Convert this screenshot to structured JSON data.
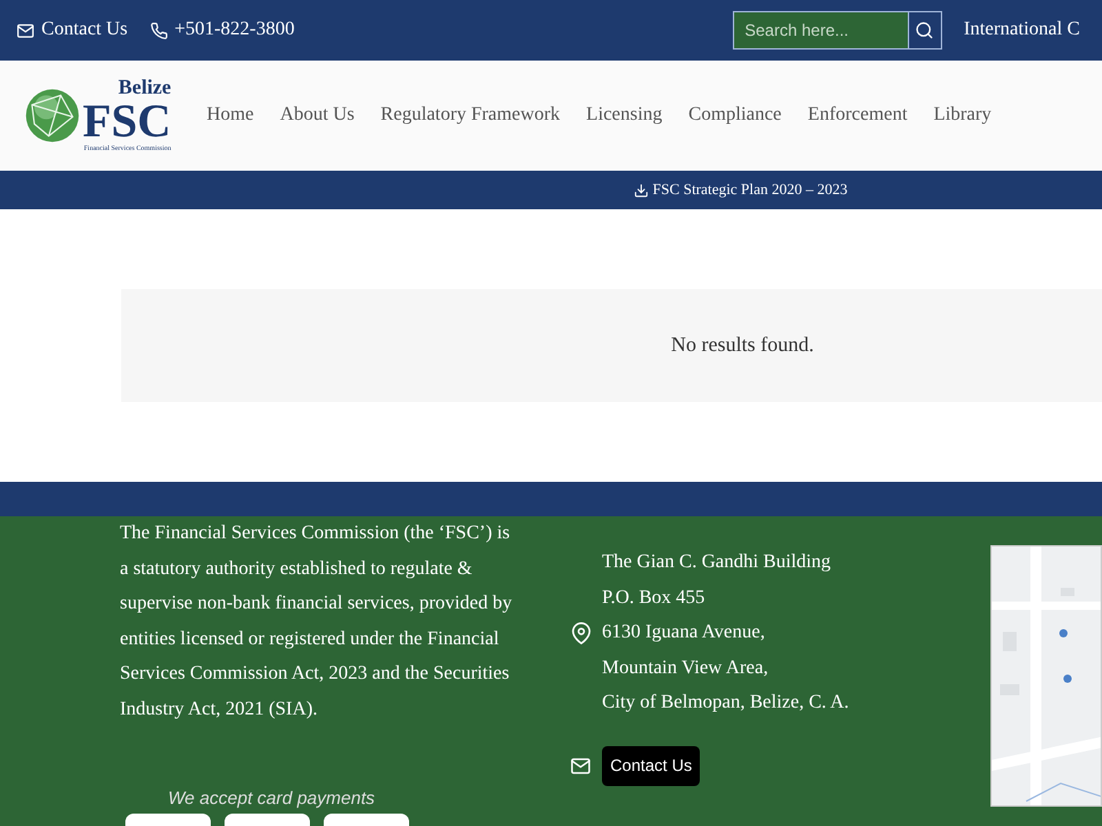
{
  "top_bar": {
    "contact": "Contact Us",
    "phone": "+501-822-3800",
    "search": {
      "placeholder": "Search here..."
    },
    "language": "International C"
  },
  "logo": {
    "title": "Belize",
    "acronym": "FSC",
    "subtitle": "Financial Services Commission"
  },
  "nav": [
    {
      "label": "Home"
    },
    {
      "label": "About Us"
    },
    {
      "label": "Regulatory Framework"
    },
    {
      "label": "Licensing"
    },
    {
      "label": "Compliance"
    },
    {
      "label": "Enforcement"
    },
    {
      "label": "Library"
    }
  ],
  "announcement": "FSC Strategic Plan 2020 – 2023",
  "results": {
    "message": "No results found."
  },
  "footer": {
    "about": "The Financial Services Commission (the ‘FSC’) is a statutory authority established to regulate & supervise non-bank financial services, provided by entities licensed or registered under the Financial Services Commission Act, 2023 and the Securities Industry Act, 2021 (SIA).",
    "address": [
      "The Gian C. Gandhi Building",
      "P.O. Box 455",
      "6130 Iguana Avenue,",
      "Mountain View Area,",
      "City of Belmopan, Belize, C. A."
    ],
    "contact_button": "Contact Us",
    "payments": "We accept card payments"
  }
}
